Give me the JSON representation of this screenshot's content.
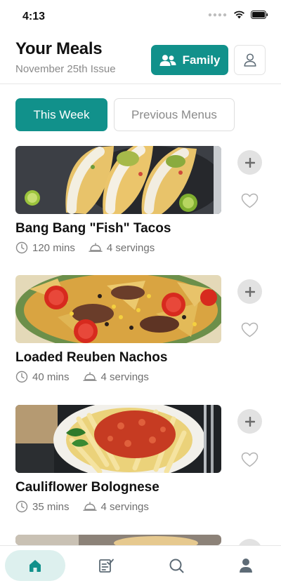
{
  "status_bar": {
    "time": "4:13"
  },
  "header": {
    "title": "Your Meals",
    "subtitle": "November 25th Issue",
    "family_button": "Family"
  },
  "tabs": [
    {
      "label": "This Week",
      "active": true
    },
    {
      "label": "Previous Menus",
      "active": false
    }
  ],
  "meals": [
    {
      "name": "Bang Bang \"Fish\" Tacos",
      "time": "120 mins",
      "servings": "4 servings"
    },
    {
      "name": "Loaded Reuben Nachos",
      "time": "40 mins",
      "servings": "4 servings"
    },
    {
      "name": "Cauliflower Bolognese",
      "time": "35 mins",
      "servings": "4 servings"
    }
  ],
  "bottom_nav": [
    {
      "icon": "home-icon",
      "active": true
    },
    {
      "icon": "checklist-icon",
      "active": false
    },
    {
      "icon": "search-icon",
      "active": false
    },
    {
      "icon": "person-icon",
      "active": false
    }
  ],
  "colors": {
    "accent": "#11918b",
    "accent_light": "#ddf0ee",
    "muted": "#8a8a8a"
  }
}
